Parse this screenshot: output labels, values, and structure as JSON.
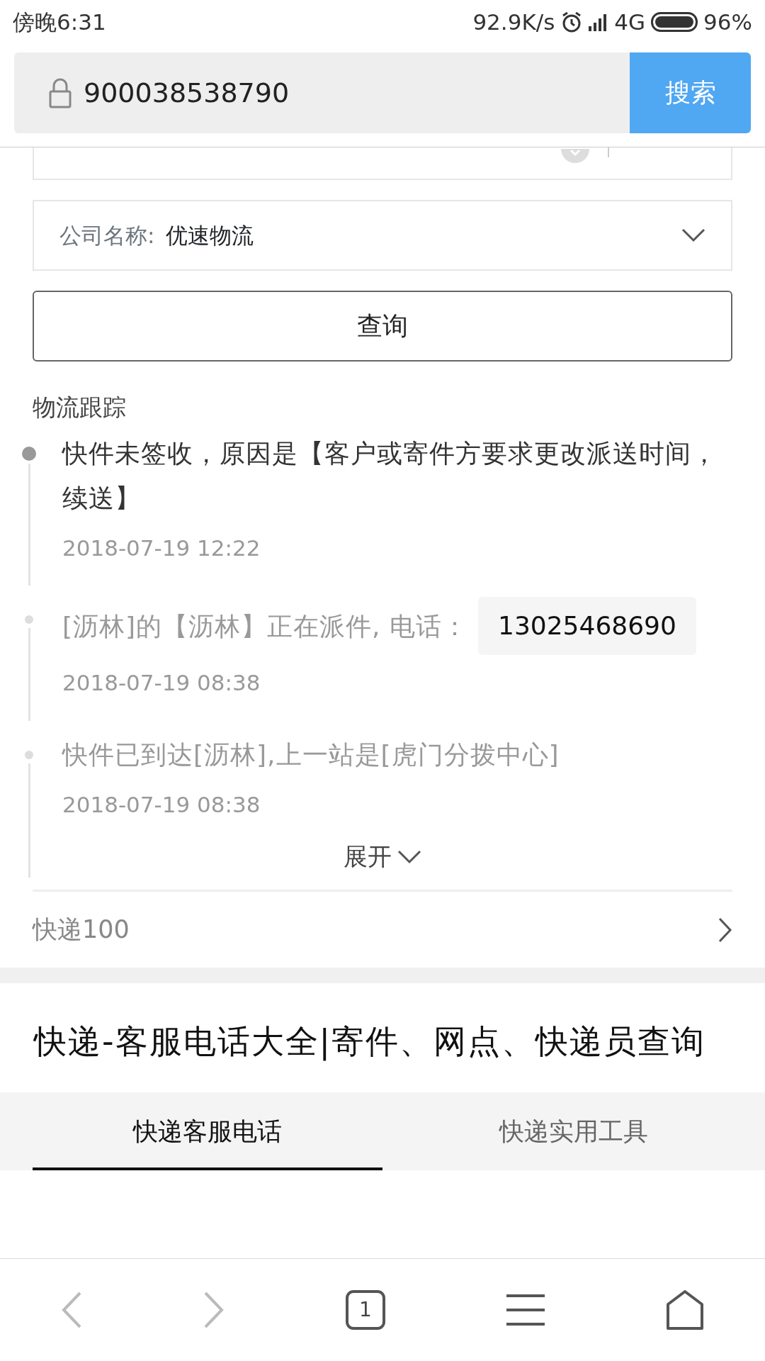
{
  "status_bar": {
    "time": "傍晚6:31",
    "net_speed": "92.9K/s",
    "network": "4G",
    "battery": "96%"
  },
  "address_bar": {
    "value": "900038538790",
    "button": "搜索"
  },
  "query_form": {
    "company_label": "公司名称:",
    "company_value": "优速物流",
    "query_button": "查询"
  },
  "tracking": {
    "title": "物流跟踪",
    "events": [
      {
        "text": "快件未签收，原因是【客户或寄件方要求更改派送时间，续送】",
        "time": "2018-07-19 12:22",
        "latest": true
      },
      {
        "text": "[沥林]的【沥林】正在派件, 电话：",
        "phone": "13025468690",
        "time": "2018-07-19 08:38",
        "latest": false
      },
      {
        "text": "快件已到达[沥林],上一站是[虎门分拨中心]",
        "time": "2018-07-19 08:38",
        "latest": false
      }
    ],
    "expand": "展开"
  },
  "source_link": "快递100",
  "article_title": "快递-客服电话大全|寄件、网点、快递员查询",
  "tabs": [
    {
      "label": "快递客服电话",
      "selected": true
    },
    {
      "label": "快递实用工具",
      "selected": false
    }
  ],
  "nav_bar": {
    "tab_count": "1"
  }
}
